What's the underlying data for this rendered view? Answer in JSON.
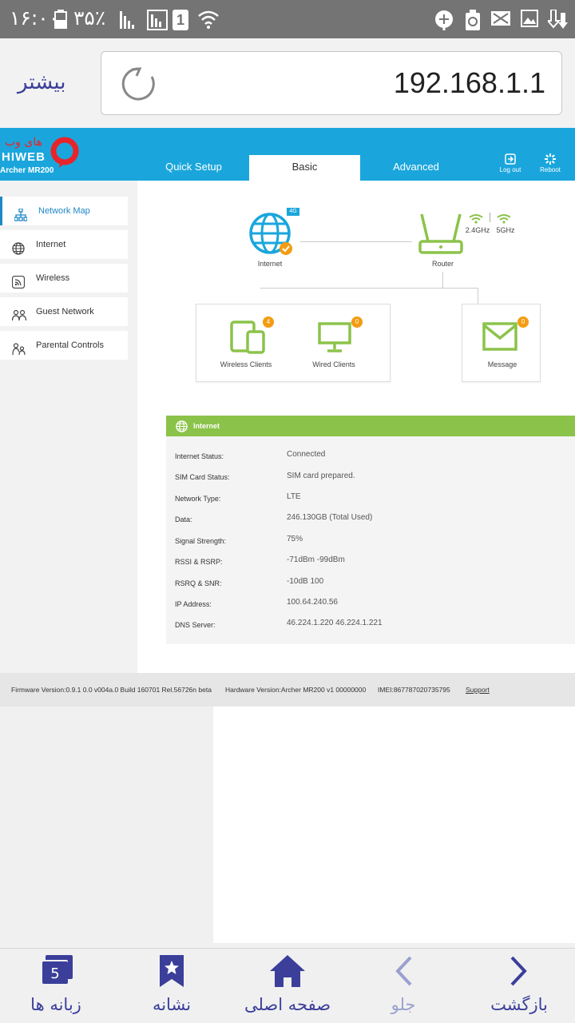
{
  "statusbar": {
    "time": "۱۶:۰۰",
    "battery_pct": "۳۵٪",
    "sim_label": "1"
  },
  "browser": {
    "more_label": "بیشتر",
    "url": "192.168.1.1"
  },
  "router": {
    "brand": "HIWEB",
    "brand_fa": "های وب",
    "model": "Archer MR200",
    "tabs": [
      "Quick Setup",
      "Basic",
      "Advanced"
    ],
    "active_tab": "Basic",
    "logout_label": "Log out",
    "reboot_label": "Reboot",
    "accent_color": "#1aa6dc",
    "green_color": "#8bc34a"
  },
  "sidebar": {
    "items": [
      {
        "label": "Network Map",
        "icon": "network-map-icon"
      },
      {
        "label": "Internet",
        "icon": "globe-icon"
      },
      {
        "label": "Wireless",
        "icon": "wireless-icon"
      },
      {
        "label": "Guest Network",
        "icon": "guests-icon"
      },
      {
        "label": "Parental Controls",
        "icon": "parental-icon"
      }
    ]
  },
  "map": {
    "internet_label": "Internet",
    "internet_badge": "4G",
    "router_label": "Router",
    "band_24": "2.4GHz",
    "band_5": "5GHz",
    "wireless_clients_label": "Wireless Clients",
    "wireless_clients_count": "4",
    "wired_clients_label": "Wired Clients",
    "wired_clients_count": "0",
    "message_label": "Message",
    "message_count": "0"
  },
  "internet_panel": {
    "title": "Internet",
    "rows": [
      {
        "key": "Internet Status:",
        "value": "Connected"
      },
      {
        "key": "SIM Card Status:",
        "value": "SIM card prepared."
      },
      {
        "key": "Network Type:",
        "value": "LTE"
      },
      {
        "key": "Data:",
        "value": "246.130GB (Total Used)"
      },
      {
        "key": "Signal Strength:",
        "value": "75%"
      },
      {
        "key": "RSSI & RSRP:",
        "value": "-71dBm  -99dBm"
      },
      {
        "key": "RSRQ & SNR:",
        "value": "-10dB  100"
      },
      {
        "key": "IP Address:",
        "value": "100.64.240.56"
      },
      {
        "key": "DNS Server:",
        "value": "46.224.1.220 46.224.1.221"
      }
    ]
  },
  "footer": {
    "firmware": "Firmware Version:0.9.1 0.0 v004a.0 Build 160701 Rel.56726n beta",
    "hardware": "Hardware Version:Archer MR200 v1 00000000",
    "imei": "IMEI:867787020735795",
    "support": "Support"
  },
  "bottomnav": {
    "tabs_count": "5",
    "tabs_label": "زبانه ها",
    "bookmark_label": "نشانه",
    "home_label": "صفحه اصلی",
    "forward_label": "جلو",
    "back_label": "بازگشت"
  }
}
